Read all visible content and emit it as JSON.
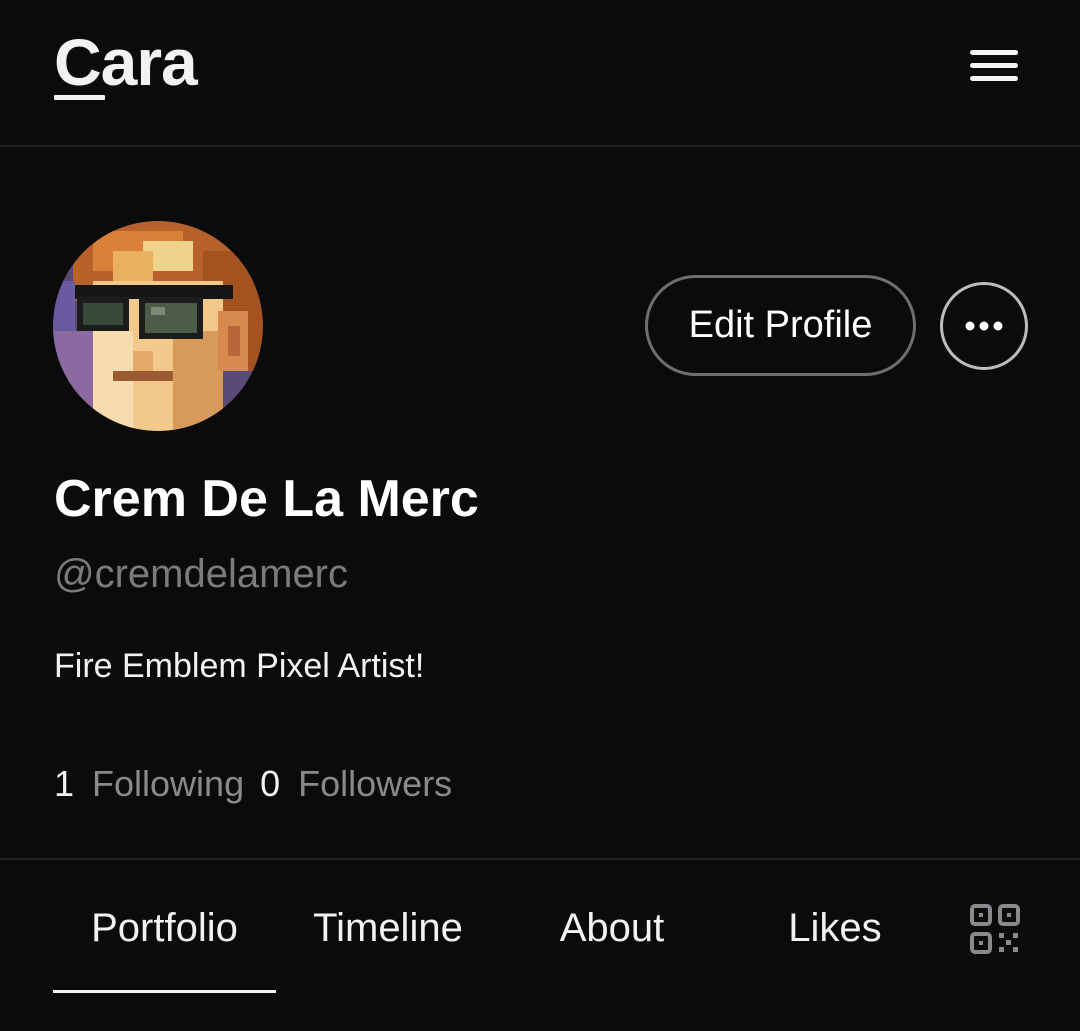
{
  "app": {
    "logo_text": "Cara"
  },
  "profile": {
    "display_name": "Crem De La Merc",
    "handle": "@cremdelamerc",
    "bio": "Fire Emblem Pixel Artist!",
    "edit_label": "Edit Profile",
    "following_count": "1",
    "following_label": "Following",
    "followers_count": "0",
    "followers_label": "Followers"
  },
  "tabs": [
    {
      "label": "Portfolio",
      "active": true
    },
    {
      "label": "Timeline",
      "active": false
    },
    {
      "label": "About",
      "active": false
    },
    {
      "label": "Likes",
      "active": false
    }
  ],
  "icons": {
    "menu": "hamburger-menu-icon",
    "more": "more-dots-icon",
    "qr": "qr-code-icon"
  },
  "colors": {
    "background": "#0b0b0c",
    "text": "#ffffff",
    "muted": "#7b7b7f",
    "divider": "#222226"
  }
}
